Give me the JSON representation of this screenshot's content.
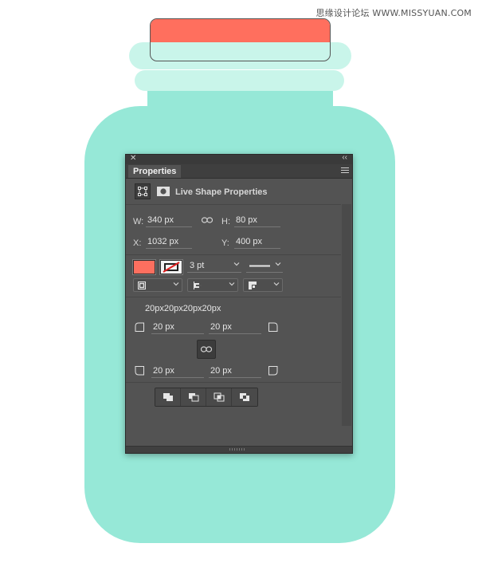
{
  "watermark": "思缘设计论坛 WWW.MISSYUAN.COM",
  "colors": {
    "jar_body": "#96e8d7",
    "jar_ring": "#c9f5ea",
    "lid_fill": "#ff6f5e",
    "panel_bg": "#535353"
  },
  "panel": {
    "close_glyph": "✕",
    "collapse_glyph": "‹‹",
    "tab_label": "Properties",
    "header_title": "Live Shape Properties",
    "transform": {
      "w_label": "W:",
      "w_value": "340 px",
      "h_label": "H:",
      "h_value": "80 px",
      "x_label": "X:",
      "x_value": "1032 px",
      "y_label": "Y:",
      "y_value": "400 px"
    },
    "appearance": {
      "fill_color": "#fd6f5f",
      "stroke_width": "3 pt",
      "stroke_type_icon": "solid-line-icon",
      "align_icon": "stroke-align-inside-icon",
      "caps_icon": "stroke-caps-icon",
      "corners_icon": "stroke-corners-icon"
    },
    "corners": {
      "summary": "20px20px20px20px",
      "top_left": "20 px",
      "top_right": "20 px",
      "bottom_left": "20 px",
      "bottom_right": "20 px"
    },
    "path_operations": [
      "combine-shapes-icon",
      "subtract-front-icon",
      "intersect-shapes-icon",
      "exclude-overlap-icon"
    ]
  }
}
